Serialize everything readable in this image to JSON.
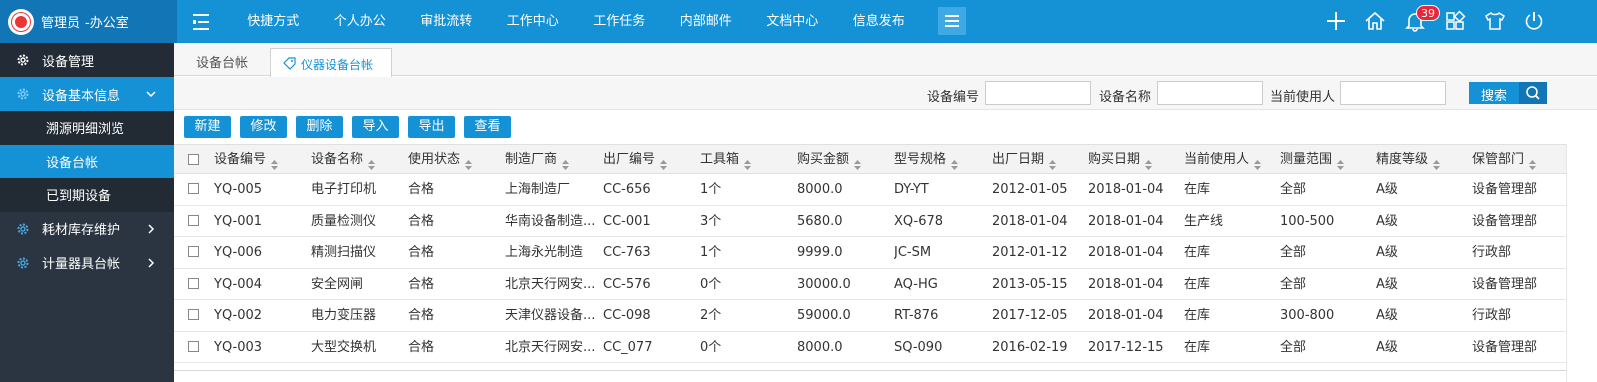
{
  "brand": {
    "user": "管理员",
    "dept": "-办公室"
  },
  "topnav": [
    "快捷方式",
    "个人办公",
    "审批流转",
    "工作中心",
    "工作任务",
    "内部邮件",
    "文档中心",
    "信息发布"
  ],
  "header_icons": {
    "add": "plus-icon",
    "home": "home-icon",
    "notify": "bell-icon",
    "notify_count": "39",
    "apps": "apps-icon",
    "skin": "shirt-icon",
    "power": "power-icon"
  },
  "sidebar": {
    "title": "设备管理",
    "groups": [
      {
        "label": "设备基本信息",
        "children": [
          "溯源明细浏览",
          "设备台帐",
          "已到期设备"
        ],
        "selected": "设备台帐"
      },
      {
        "label": "耗材库存维护"
      },
      {
        "label": "计量器具台帐"
      }
    ]
  },
  "tabs": [
    "设备台帐",
    "仪器设备台帐"
  ],
  "search": {
    "label1": "设备编号",
    "label2": "设备名称",
    "label3": "当前使用人",
    "button": "搜索"
  },
  "toolbar": [
    "新建",
    "修改",
    "删除",
    "导入",
    "导出",
    "查看"
  ],
  "table": {
    "columns": [
      "设备编号",
      "设备名称",
      "使用状态",
      "制造厂商",
      "出厂编号",
      "工具箱",
      "购买金额",
      "型号规格",
      "出厂日期",
      "购买日期",
      "当前使用人",
      "测量范围",
      "精度等级",
      "保管部门"
    ],
    "rows": [
      [
        "YQ-005",
        "电子打印机",
        "合格",
        "上海制造厂",
        "CC-656",
        "1个",
        "8000.0",
        "DY-YT",
        "2012-01-05",
        "2018-01-04",
        "在库",
        "全部",
        "A级",
        "设备管理部"
      ],
      [
        "YQ-001",
        "质量检测仪",
        "合格",
        "华南设备制造...",
        "CC-001",
        "3个",
        "5680.0",
        "XQ-678",
        "2018-01-04",
        "2018-01-04",
        "生产线",
        "100-500",
        "A级",
        "设备管理部"
      ],
      [
        "YQ-006",
        "精测扫描仪",
        "合格",
        "上海永光制造",
        "CC-763",
        "1个",
        "9999.0",
        "JC-SM",
        "2012-01-12",
        "2018-01-04",
        "在库",
        "全部",
        "A级",
        "行政部"
      ],
      [
        "YQ-004",
        "安全网闸",
        "合格",
        "北京天行网安...",
        "CC-576",
        "0个",
        "30000.0",
        "AQ-HG",
        "2013-05-15",
        "2018-01-04",
        "在库",
        "全部",
        "A级",
        "设备管理部"
      ],
      [
        "YQ-002",
        "电力变压器",
        "合格",
        "天津仪器设备...",
        "CC-098",
        "2个",
        "59000.0",
        "RT-876",
        "2017-12-05",
        "2018-01-04",
        "在库",
        "300-800",
        "A级",
        "行政部"
      ],
      [
        "YQ-003",
        "大型交换机",
        "合格",
        "北京天行网安...",
        "CC_077",
        "0个",
        "8000.0",
        "SQ-090",
        "2016-02-19",
        "2017-12-15",
        "在库",
        "全部",
        "A级",
        "设备管理部"
      ]
    ]
  },
  "colors": {
    "primary": "#1592d6",
    "sidebar": "#2b3541",
    "badge": "#e8263a"
  }
}
